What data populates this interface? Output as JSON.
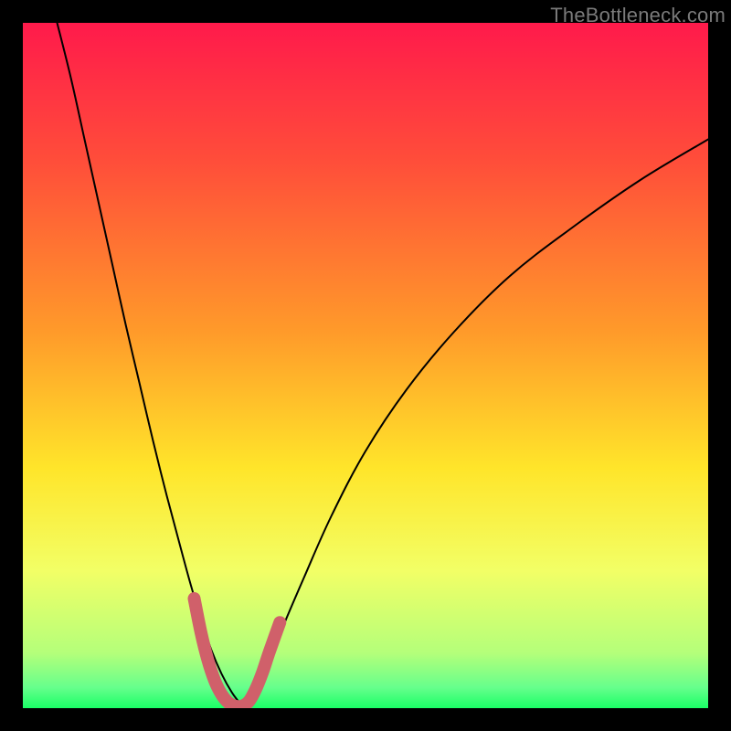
{
  "watermark": "TheBottleneck.com",
  "chart_data": {
    "type": "line",
    "title": "",
    "xlabel": "",
    "ylabel": "",
    "xlim": [
      0,
      100
    ],
    "ylim": [
      0,
      100
    ],
    "gradient_stops": [
      {
        "offset": 0,
        "color": "#ff1a4b"
      },
      {
        "offset": 20,
        "color": "#ff4d3a"
      },
      {
        "offset": 45,
        "color": "#ff9a2a"
      },
      {
        "offset": 65,
        "color": "#ffe52a"
      },
      {
        "offset": 80,
        "color": "#f2ff66"
      },
      {
        "offset": 92,
        "color": "#b4ff7a"
      },
      {
        "offset": 97,
        "color": "#66ff8c"
      },
      {
        "offset": 100,
        "color": "#1aff66"
      }
    ],
    "series": [
      {
        "name": "left-curve",
        "x": [
          5,
          7,
          9,
          11,
          13,
          15,
          17,
          19,
          21,
          23,
          24.5,
          26,
          27.5,
          29,
          30.5,
          32
        ],
        "y": [
          100,
          92,
          83,
          74,
          65,
          56,
          47.5,
          39,
          31,
          23.5,
          18,
          13,
          8.5,
          5,
          2.3,
          0.3
        ]
      },
      {
        "name": "right-curve",
        "x": [
          32,
          34,
          36,
          38,
          41,
          45,
          50,
          56,
          63,
          71,
          80,
          90,
          100
        ],
        "y": [
          0.3,
          3,
          7,
          12,
          19,
          28,
          37.5,
          46.5,
          55,
          63,
          70,
          77,
          83
        ]
      },
      {
        "name": "trough-highlight",
        "x": [
          25,
          26,
          27,
          28,
          29,
          30,
          31,
          32,
          33,
          34,
          35,
          36,
          37.5
        ],
        "y": [
          16,
          11,
          7,
          4,
          2,
          0.8,
          0.3,
          0.3,
          1,
          2.8,
          5.3,
          8.3,
          12.5
        ]
      }
    ]
  }
}
